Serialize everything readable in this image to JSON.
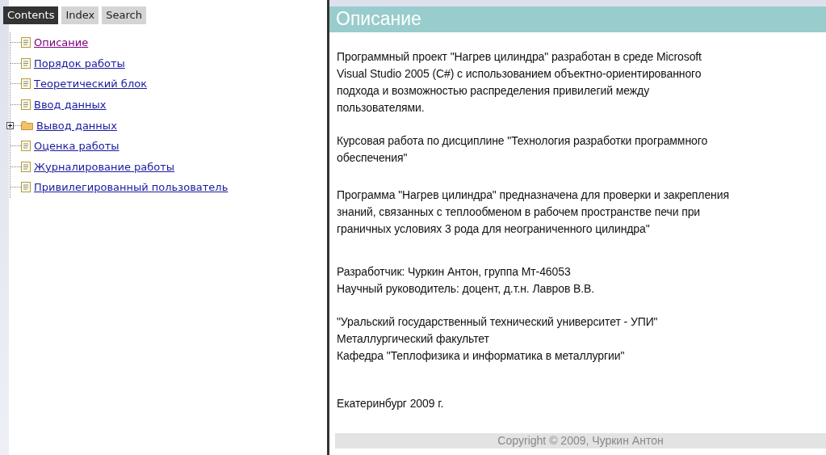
{
  "tabs": [
    {
      "label": "Contents",
      "selected": true
    },
    {
      "label": "Index",
      "selected": false
    },
    {
      "label": "Search",
      "selected": false
    }
  ],
  "tree": [
    {
      "kind": "page",
      "label": "Описание",
      "visited": true
    },
    {
      "kind": "page",
      "label": "Порядок работы",
      "visited": false
    },
    {
      "kind": "page",
      "label": "Теоретический блок",
      "visited": false
    },
    {
      "kind": "page",
      "label": "Ввод данных",
      "visited": false
    },
    {
      "kind": "folder",
      "label": "Вывод данных",
      "visited": false,
      "expanded": false
    },
    {
      "kind": "page",
      "label": "Оценка работы",
      "visited": false
    },
    {
      "kind": "page",
      "label": "Журналирование работы",
      "visited": false
    },
    {
      "kind": "page",
      "label": "Привилегированный пользователь",
      "visited": false
    }
  ],
  "topic": {
    "title": "Описание",
    "paragraphs": [
      [
        "Программный проект \"Нагрев цилиндра\" разработан в среде Microsoft",
        "Visual Studio 2005 (C#) с использованием объектно-ориентированного",
        "подхода и возможностью распределения привилегий между",
        "пользователями."
      ],
      [
        "Курсовая работа по дисциплине \"Технология разработки программного",
        "обеспечения\""
      ],
      [
        "Программа \"Нагрев цилиндра\" предназначена для проверки и закрепления",
        "знаний, связанных с теплообменом в рабочем пространстве печи при",
        "граничных условиях 3 рода для неограниченного цилиндра\""
      ],
      [
        "Разработчик: Чуркин Антон, группа Мт-46053",
        "Научный руководитель: доцент, д.т.н. Лавров В.В."
      ],
      [
        "\"Уральский государственный технический университет - УПИ\"",
        "Металлургический факультет",
        "Кафедра \"Теплофизика и информатика в металлургии\""
      ],
      [
        "Екатеринбург 2009 г."
      ]
    ],
    "copyright": "Copyright © 2009, Чуркин Антон"
  }
}
